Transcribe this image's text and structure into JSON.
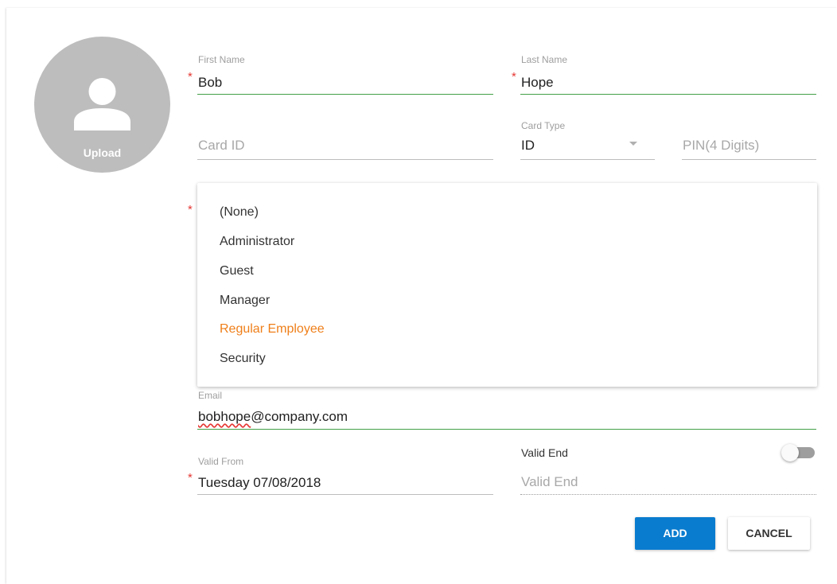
{
  "avatar": {
    "upload_label": "Upload"
  },
  "first_name": {
    "label": "First Name",
    "value": "Bob",
    "required_mark": "*"
  },
  "last_name": {
    "label": "Last Name",
    "value": "Hope",
    "required_mark": "*"
  },
  "card_id": {
    "placeholder": "Card ID"
  },
  "card_type": {
    "label": "Card Type",
    "value": "ID"
  },
  "pin": {
    "placeholder": "PIN(4 Digits)"
  },
  "role": {
    "required_mark": "*",
    "options": [
      "(None)",
      "Administrator",
      "Guest",
      "Manager",
      "Regular Employee",
      "Security"
    ],
    "selected": "Regular Employee"
  },
  "email": {
    "label": "Email",
    "value_user": "bobhope",
    "value_domain": "@company.com"
  },
  "valid_from": {
    "label": "Valid From",
    "value": "Tuesday 07/08/2018",
    "required_mark": "*"
  },
  "valid_end": {
    "label": "Valid End",
    "placeholder": "Valid End",
    "enabled": false
  },
  "actions": {
    "add_label": "ADD",
    "cancel_label": "CANCEL"
  },
  "colors": {
    "accent": "#0a7ccf",
    "focus_underline": "#43a047",
    "selected_option": "#ef7f1a",
    "required": "#e53935"
  }
}
